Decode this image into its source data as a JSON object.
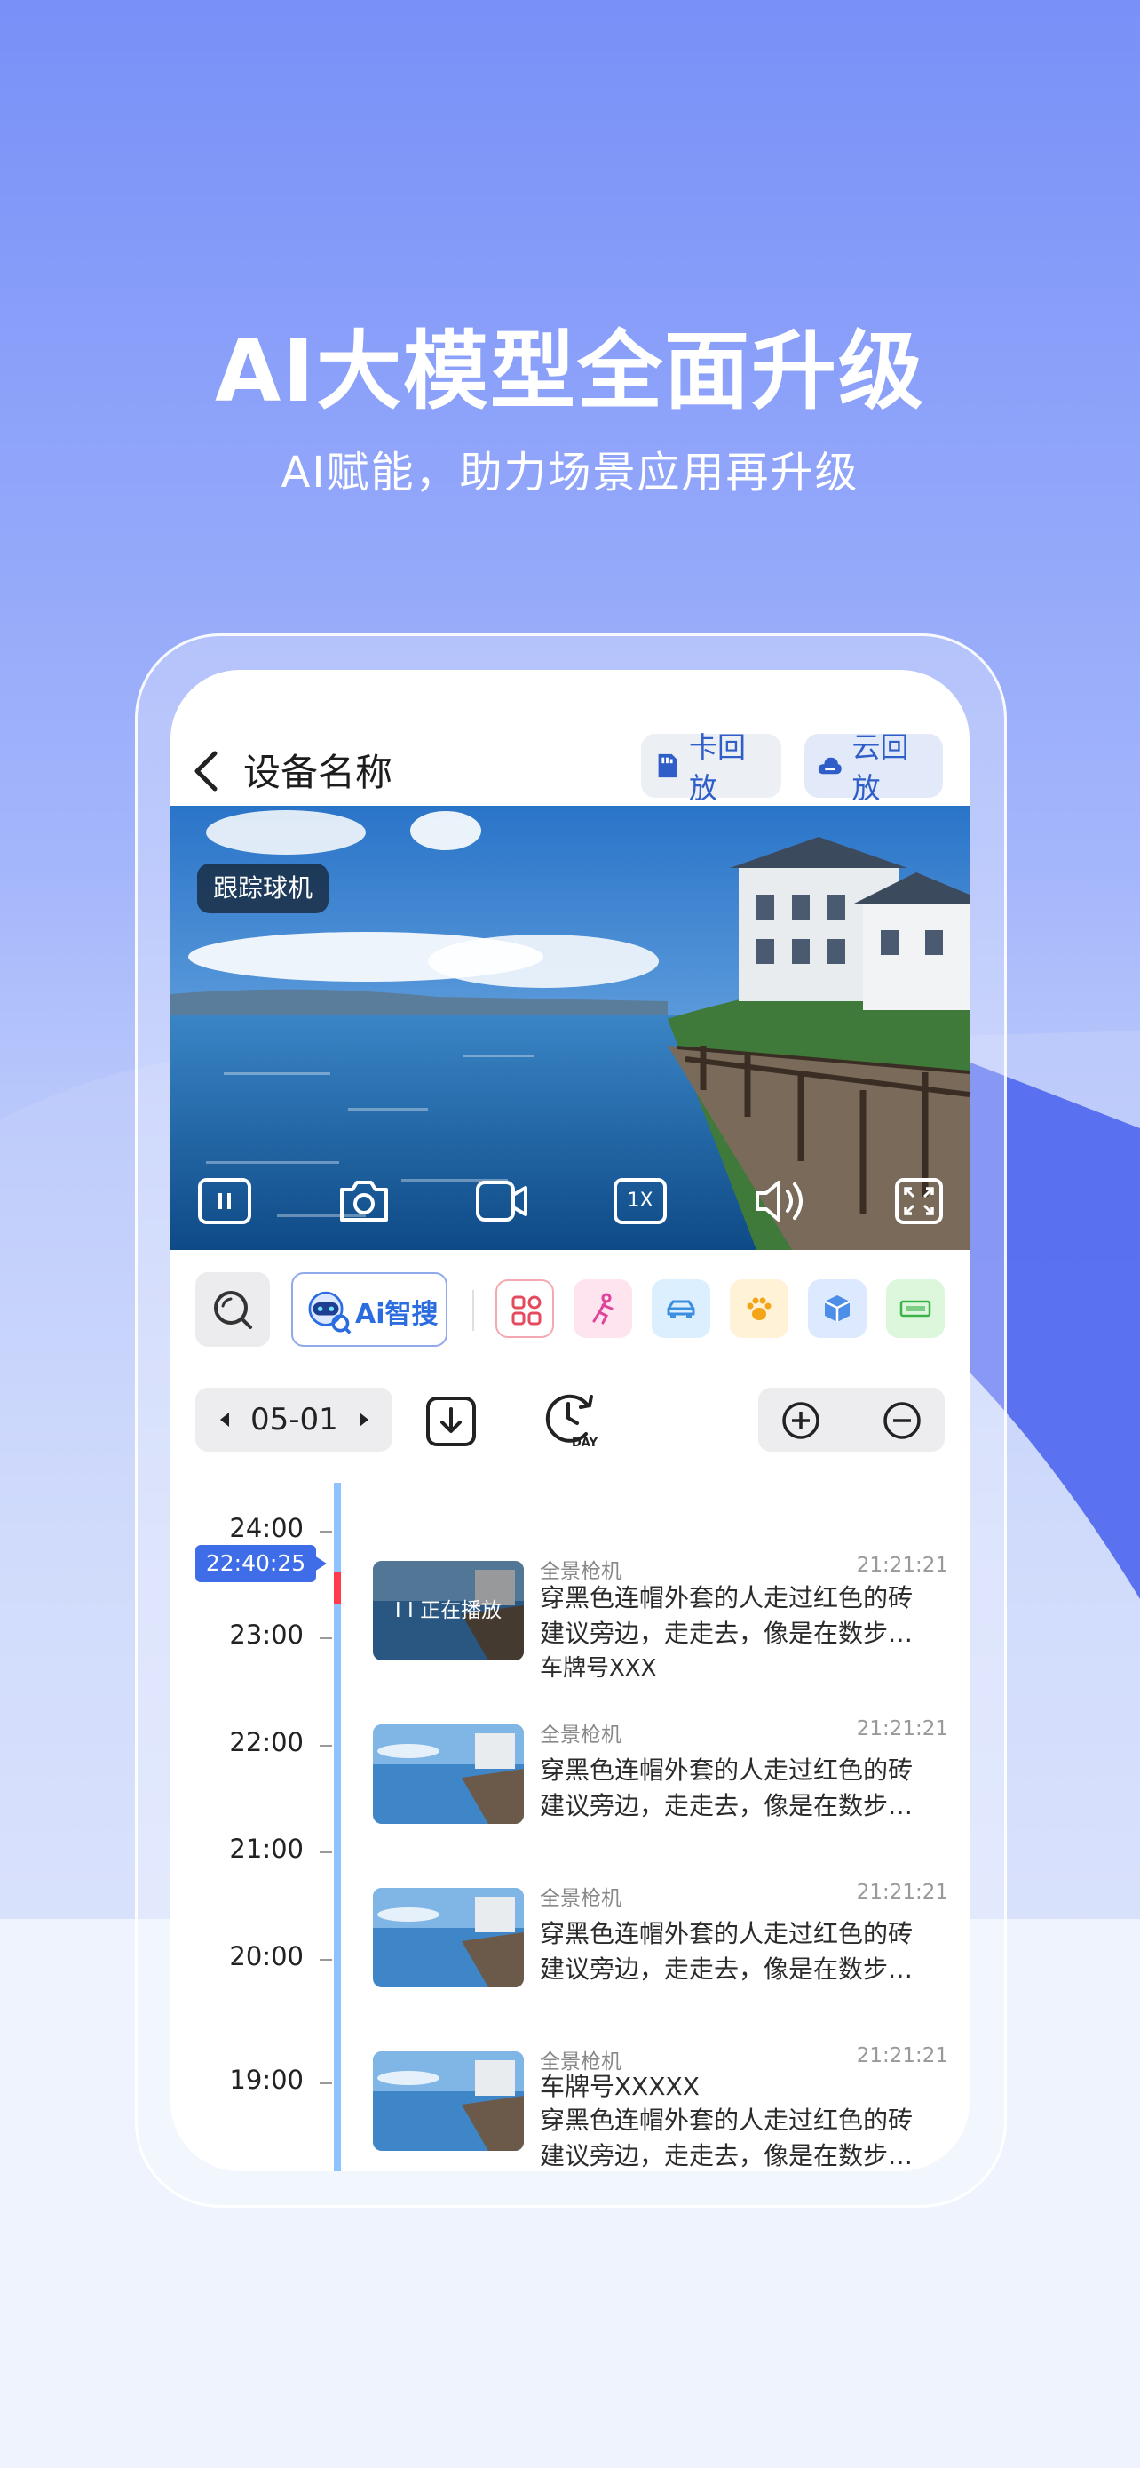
{
  "hero": {
    "title": "AI大模型全面升级",
    "subtitle": "AI赋能，助力场景应用再升级"
  },
  "header": {
    "title": "设备名称",
    "card_playback": "卡回放",
    "cloud_playback": "云回放"
  },
  "video": {
    "tag": "跟踪球机",
    "speed": "1X"
  },
  "toolbar": {
    "ai_search": "Ai智搜",
    "categories": [
      "grid-icon",
      "person-icon",
      "car-icon",
      "pet-icon",
      "package-icon",
      "plate-icon"
    ]
  },
  "date": {
    "value": "05-01"
  },
  "timeline": {
    "hours": [
      "24:00",
      "23:00",
      "22:00",
      "21:00",
      "20:00",
      "19:00"
    ],
    "current_time": "22:40:25",
    "playing_label": "I I 正在播放"
  },
  "events": [
    {
      "camera": "全景枪机",
      "time": "21:21:21",
      "lines": [
        "穿黑色连帽外套的人走过红色的砖",
        "建议旁边，走走去，像是在数步…",
        "车牌号XXX"
      ]
    },
    {
      "camera": "全景枪机",
      "time": "21:21:21",
      "lines": [
        "穿黑色连帽外套的人走过红色的砖",
        "建议旁边，走走去，像是在数步…"
      ]
    },
    {
      "camera": "全景枪机",
      "time": "21:21:21",
      "lines": [
        "穿黑色连帽外套的人走过红色的砖",
        "建议旁边，走走去，像是在数步…"
      ]
    },
    {
      "camera": "全景枪机",
      "time": "21:21:21",
      "lines": [
        "车牌号XXXXX",
        "穿黑色连帽外套的人走过红色的砖",
        "建议旁边，走走去，像是在数步…"
      ]
    }
  ],
  "colors": {
    "accent": "#3f6de8",
    "timeline": "#8fc3ff",
    "marker": "#ff3b4d"
  }
}
